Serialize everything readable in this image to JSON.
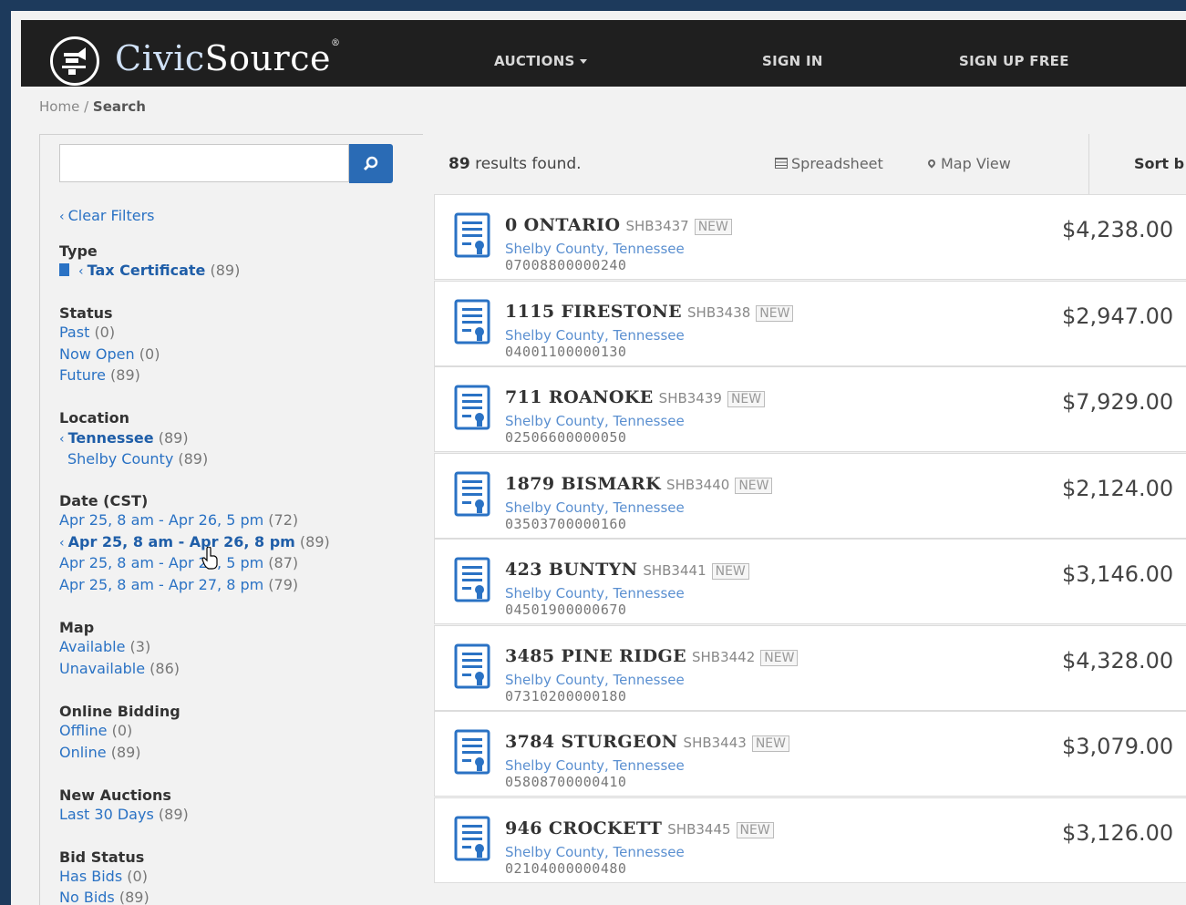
{
  "header": {
    "logo_civic": "Civic",
    "logo_source": "Source",
    "logo_reg": "®",
    "nav": {
      "auctions": "AUCTIONS",
      "sign_in": "SIGN IN",
      "sign_up": "SIGN UP FREE"
    }
  },
  "breadcrumb": {
    "home": "Home",
    "sep": "/",
    "current": "Search"
  },
  "search": {
    "placeholder": ""
  },
  "filters": {
    "clear": "Clear Filters",
    "type": {
      "heading": "Type",
      "selected": "Tax Certificate",
      "count": "(89)"
    },
    "status": {
      "heading": "Status",
      "items": [
        {
          "label": "Past",
          "count": "(0)"
        },
        {
          "label": "Now Open",
          "count": "(0)"
        },
        {
          "label": "Future",
          "count": "(89)"
        }
      ]
    },
    "location": {
      "heading": "Location",
      "selected": {
        "label": "Tennessee",
        "count": "(89)"
      },
      "sub": {
        "label": "Shelby County",
        "count": "(89)"
      }
    },
    "date": {
      "heading": "Date (CST)",
      "items": [
        {
          "label": "Apr 25, 8 am - Apr 26, 5 pm",
          "count": "(72)"
        },
        {
          "label": "Apr 25, 8 am - Apr 26, 8 pm",
          "count": "(89)"
        },
        {
          "label": "Apr 25, 8 am - Apr 27, 5 pm",
          "count": "(87)"
        },
        {
          "label": "Apr 25, 8 am - Apr 27, 8 pm",
          "count": "(79)"
        }
      ]
    },
    "map": {
      "heading": "Map",
      "items": [
        {
          "label": "Available",
          "count": "(3)"
        },
        {
          "label": "Unavailable",
          "count": "(86)"
        }
      ]
    },
    "online": {
      "heading": "Online Bidding",
      "items": [
        {
          "label": "Offline",
          "count": "(0)"
        },
        {
          "label": "Online",
          "count": "(89)"
        }
      ]
    },
    "new_auctions": {
      "heading": "New Auctions",
      "items": [
        {
          "label": "Last 30 Days",
          "count": "(89)"
        }
      ]
    },
    "bid_status": {
      "heading": "Bid Status",
      "items": [
        {
          "label": "Has Bids",
          "count": "(0)"
        },
        {
          "label": "No Bids",
          "count": "(89)"
        }
      ]
    }
  },
  "results_header": {
    "count": "89",
    "suffix": "results found.",
    "spreadsheet": "Spreadsheet",
    "map_view": "Map View",
    "sort": "Sort b"
  },
  "results": [
    {
      "title": "0 ONTARIO",
      "code": "SHB3437",
      "badge": "NEW",
      "county": "Shelby County, Tennessee",
      "parcel": "07008800000240",
      "price": "$4,238.00"
    },
    {
      "title": "1115 FIRESTONE",
      "code": "SHB3438",
      "badge": "NEW",
      "county": "Shelby County, Tennessee",
      "parcel": "04001100000130",
      "price": "$2,947.00"
    },
    {
      "title": "711 ROANOKE",
      "code": "SHB3439",
      "badge": "NEW",
      "county": "Shelby County, Tennessee",
      "parcel": "02506600000050",
      "price": "$7,929.00"
    },
    {
      "title": "1879 BISMARK",
      "code": "SHB3440",
      "badge": "NEW",
      "county": "Shelby County, Tennessee",
      "parcel": "03503700000160",
      "price": "$2,124.00"
    },
    {
      "title": "423 BUNTYN",
      "code": "SHB3441",
      "badge": "NEW",
      "county": "Shelby County, Tennessee",
      "parcel": "04501900000670",
      "price": "$3,146.00"
    },
    {
      "title": "3485 PINE RIDGE",
      "code": "SHB3442",
      "badge": "NEW",
      "county": "Shelby County, Tennessee",
      "parcel": "07310200000180",
      "price": "$4,328.00"
    },
    {
      "title": "3784 STURGEON",
      "code": "SHB3443",
      "badge": "NEW",
      "county": "Shelby County, Tennessee",
      "parcel": "05808700000410",
      "price": "$3,079.00"
    },
    {
      "title": "946 CROCKETT",
      "code": "SHB3445",
      "badge": "NEW",
      "county": "Shelby County, Tennessee",
      "parcel": "02104000000480",
      "price": "$3,126.00"
    }
  ],
  "colors": {
    "accent": "#2a6bb5",
    "header_bg": "#1f1f1f",
    "link": "#2a72c4"
  }
}
